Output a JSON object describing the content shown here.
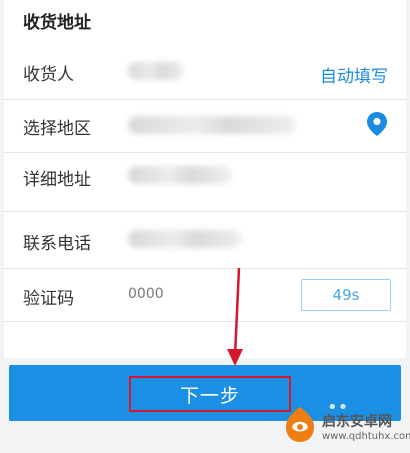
{
  "section_title": "收货地址",
  "form": {
    "recipient_label": "收货人",
    "auto_fill_label": "自动填写",
    "region_label": "选择地区",
    "detail_label": "详细地址",
    "phone_label": "联系电话",
    "code_label": "验证码",
    "code_value": "0000",
    "countdown": "49s"
  },
  "next_button_label": "下一步",
  "colors": {
    "accent_blue": "#1b8fe4",
    "highlight_red": "#d6162b"
  },
  "watermark": {
    "name": "启东安卓网",
    "url": "www.qdhtuhx.com"
  }
}
